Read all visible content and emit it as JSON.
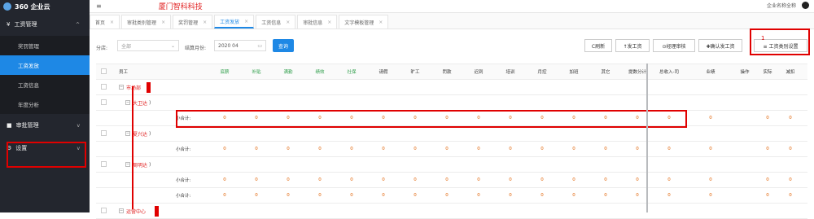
{
  "sidebar": {
    "logo_text": "360 企业云",
    "groups": [
      {
        "label": "工资管理",
        "icon": "¥",
        "arrow": "^"
      },
      {
        "label": "审批管理",
        "icon": "■",
        "arrow": "v"
      },
      {
        "label": "设置",
        "icon": "⚙",
        "arrow": "v"
      }
    ],
    "sub_items": [
      "奖罚管理",
      "工资发放",
      "工资信息",
      "年度分析"
    ]
  },
  "topbar": {
    "brand": "厦门智科科技",
    "menu_icon": "≡",
    "right_text": "企业名称全称"
  },
  "tabs": [
    {
      "label": "首页",
      "active": false
    },
    {
      "label": "审批类别管理",
      "active": false
    },
    {
      "label": "奖罚管理",
      "active": false
    },
    {
      "label": "工资发放",
      "active": true
    },
    {
      "label": "工资信息",
      "active": false
    },
    {
      "label": "审批信息",
      "active": false
    },
    {
      "label": "文字模板管理",
      "active": false
    }
  ],
  "toolbar": {
    "dept_label": "分店:",
    "dept_value": "全部",
    "month_label": "结算月份:",
    "month_value": "2020 04",
    "query_label": "查询",
    "refresh_label": "C刷新",
    "pay_label": "↑发工资",
    "audit_label": "⊙经理审核",
    "confirm_label": "✚确认发工资",
    "settings_label": "≡ 工资类别设置",
    "annotation_number": "1"
  },
  "table": {
    "columns": [
      {
        "label": "员工",
        "green": false
      },
      {
        "label": "底薪",
        "green": true
      },
      {
        "label": "补贴",
        "green": true
      },
      {
        "label": "满勤",
        "green": true
      },
      {
        "label": "绩效",
        "green": true
      },
      {
        "label": "社保",
        "green": true
      },
      {
        "label": "请假",
        "green": false
      },
      {
        "label": "旷工",
        "green": false
      },
      {
        "label": "罚款",
        "green": false
      },
      {
        "label": "迟到",
        "green": false
      },
      {
        "label": "培训",
        "green": false
      },
      {
        "label": "月控",
        "green": false
      },
      {
        "label": "加班",
        "green": false
      },
      {
        "label": "其它",
        "green": false
      },
      {
        "label": "提数分计",
        "green": false
      },
      {
        "label": "总收入-司",
        "green": false
      },
      {
        "label": "业绩",
        "green": false
      },
      {
        "label": "操作",
        "green": false
      },
      {
        "label": "实际",
        "green": false
      },
      {
        "label": "减扣",
        "green": false
      }
    ],
    "rows": [
      {
        "type": "dept",
        "name": "市场部"
      },
      {
        "type": "person",
        "name": "大卫达",
        "suffix": ")"
      },
      {
        "type": "subtotal",
        "label": "小合计:",
        "values": [
          "0",
          "0",
          "0",
          "0",
          "0",
          "0",
          "0",
          "0",
          "0",
          "0",
          "0",
          "0",
          "0",
          "0",
          "0",
          "0",
          "",
          "0",
          "0"
        ]
      },
      {
        "type": "person",
        "name": "夏兴达",
        "suffix": ")"
      },
      {
        "type": "subtotal",
        "label": "小合计:",
        "values": [
          "0",
          "0",
          "0",
          "0",
          "0",
          "0",
          "0",
          "0",
          "0",
          "0",
          "0",
          "0",
          "0",
          "0",
          "0",
          "0",
          "",
          "0",
          "0"
        ]
      },
      {
        "type": "person",
        "name": "周明达",
        "suffix": ")"
      },
      {
        "type": "subtotal",
        "label": "小合计:",
        "values": [
          "0",
          "0",
          "0",
          "0",
          "0",
          "0",
          "0",
          "0",
          "0",
          "0",
          "0",
          "0",
          "0",
          "0",
          "0",
          "0",
          "",
          "0",
          "0"
        ]
      },
      {
        "type": "subtotal",
        "label": "小合计:",
        "values": [
          "0",
          "0",
          "0",
          "0",
          "0",
          "0",
          "0",
          "0",
          "0",
          "0",
          "0",
          "0",
          "0",
          "0",
          "0",
          "0",
          "",
          "0",
          "0"
        ]
      },
      {
        "type": "dept",
        "name": "运营中心"
      }
    ]
  }
}
